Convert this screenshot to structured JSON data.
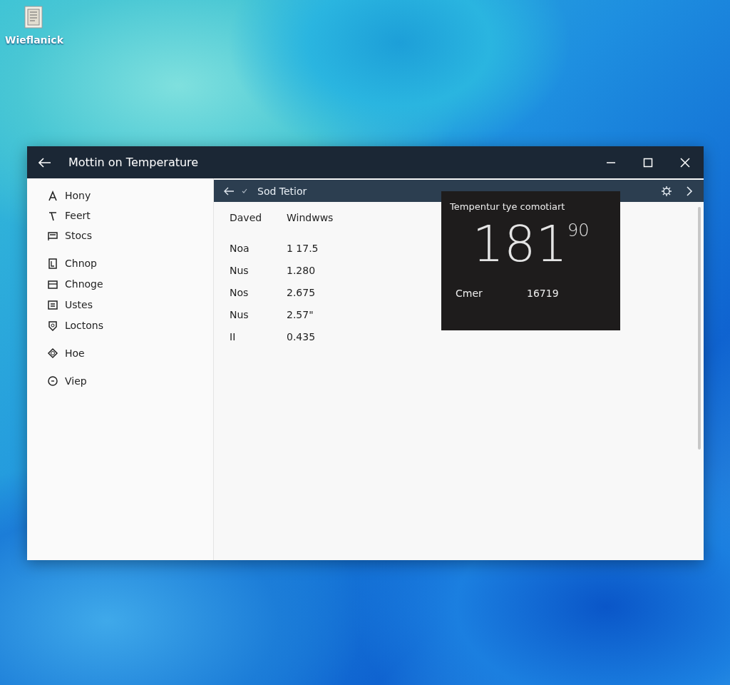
{
  "desktop_icon": {
    "label": "Wieflanick"
  },
  "window": {
    "title": "Mottin on Temperature"
  },
  "sidebar": {
    "groups": [
      {
        "items": [
          {
            "label": "Hony"
          },
          {
            "label": "Feert"
          },
          {
            "label": "Stocs"
          }
        ]
      },
      {
        "items": [
          {
            "label": "Chnop"
          },
          {
            "label": "Chnoge"
          },
          {
            "label": "Ustes"
          },
          {
            "label": "Loctons"
          }
        ]
      },
      {
        "items": [
          {
            "label": "Hoe"
          }
        ]
      },
      {
        "items": [
          {
            "label": "Viep"
          }
        ]
      }
    ]
  },
  "toolbar": {
    "title": "Sod Tetior"
  },
  "table": {
    "columns": [
      "Daved",
      "Windwws"
    ],
    "rows": [
      [
        "Noa",
        "1 17.5"
      ],
      [
        "Nus",
        "1.280"
      ],
      [
        "Nos",
        "2.675"
      ],
      [
        "Nus",
        "2.57\""
      ],
      [
        "II",
        "0.435"
      ]
    ]
  },
  "card": {
    "title": "Tempentur tye comotiart",
    "reading": "181$^{90}$",
    "label": "Cmer",
    "value": "16719"
  }
}
